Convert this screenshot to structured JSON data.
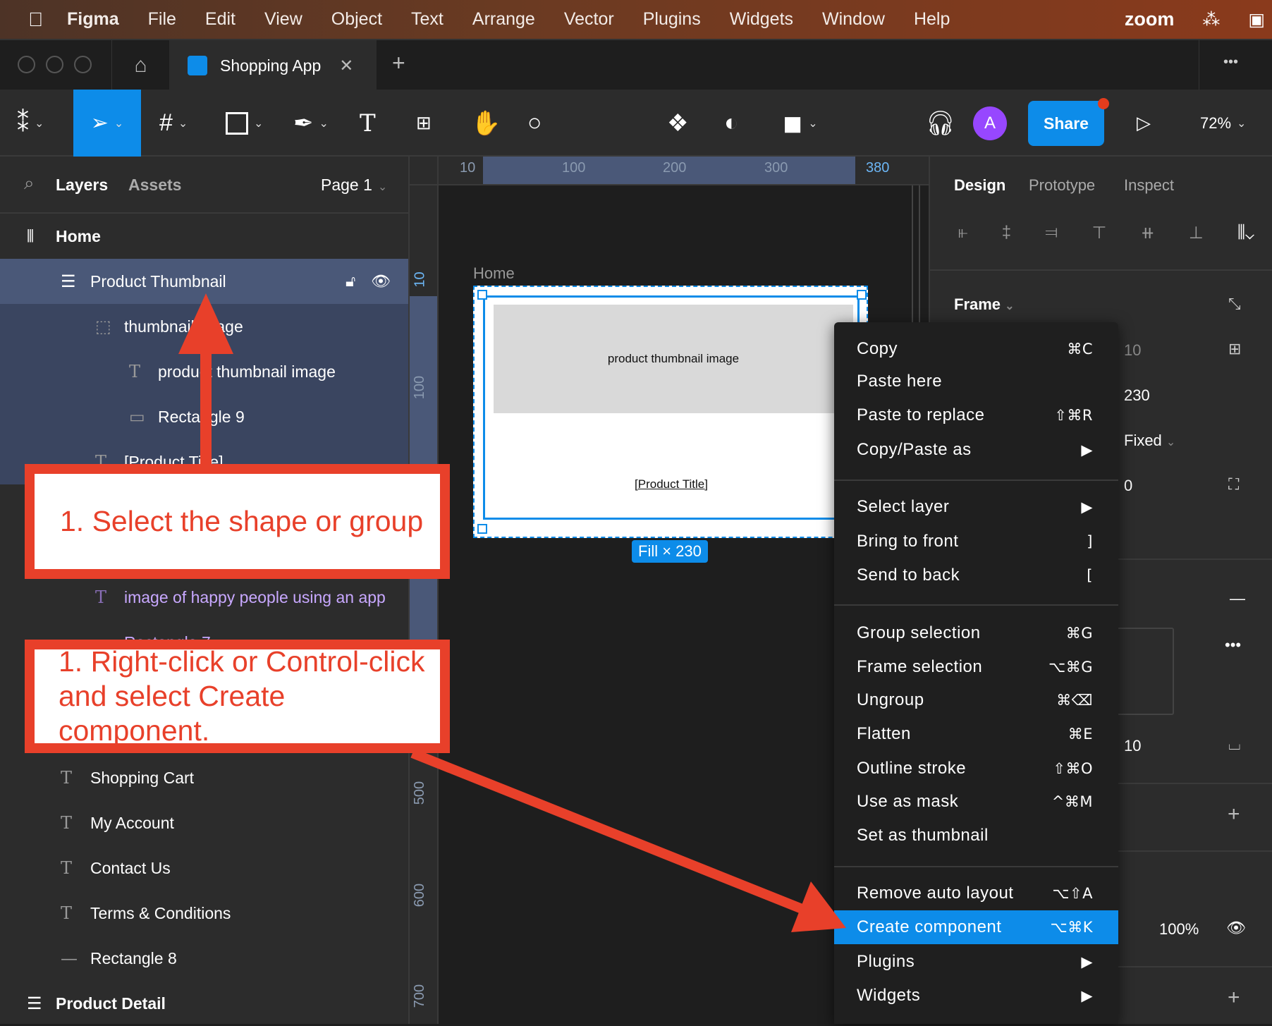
{
  "menubar": {
    "items": [
      "Figma",
      "File",
      "Edit",
      "View",
      "Object",
      "Text",
      "Arrange",
      "Vector",
      "Plugins",
      "Widgets",
      "Window",
      "Help"
    ],
    "status": [
      "zoom"
    ]
  },
  "tabbar": {
    "tab_title": "Shopping App",
    "new_tab": "+",
    "more": "•••"
  },
  "toolbar": {
    "avatar": "A",
    "share": "Share",
    "zoom": "72%",
    "accent": "#0d8ce9",
    "avatar_color": "#9747ff"
  },
  "layers": {
    "tabs": [
      "Layers",
      "Assets"
    ],
    "page": "Page 1",
    "rows": [
      {
        "label": "Home",
        "icon": "frame-grid-icon",
        "level": 0,
        "bold": true
      },
      {
        "label": "Product Thumbnail",
        "icon": "autolayout-icon",
        "level": 1,
        "selected": true
      },
      {
        "label": "thumbnail image",
        "icon": "frame-dashed-icon",
        "level": 2
      },
      {
        "label": "product thumbnail image",
        "icon": "text-icon",
        "level": 3
      },
      {
        "label": "Rectangle 9",
        "icon": "rectangle-icon",
        "level": 3
      },
      {
        "label": "[Product Title]",
        "icon": "text-icon",
        "level": 2
      },
      {
        "label": "image of happy people using an app",
        "icon": "text-icon",
        "level": 2,
        "purple": true
      },
      {
        "label": "Rectangle 7",
        "icon": "rectangle-icon",
        "level": 2,
        "purple": true
      },
      {
        "label": "Shopping Cart",
        "icon": "text-icon",
        "level": 1
      },
      {
        "label": "My Account",
        "icon": "text-icon",
        "level": 1
      },
      {
        "label": "Contact Us",
        "icon": "text-icon",
        "level": 1
      },
      {
        "label": "Terms & Conditions",
        "icon": "text-icon",
        "level": 1
      },
      {
        "label": "Rectangle 8",
        "icon": "line-icon",
        "level": 1
      },
      {
        "label": "Product Detail",
        "icon": "autolayout-icon",
        "level": 0,
        "bold": true
      }
    ]
  },
  "rulers": {
    "top": [
      "10",
      "100",
      "200",
      "300",
      "380"
    ],
    "left": [
      "10",
      "100",
      "500",
      "600",
      "700"
    ]
  },
  "canvas": {
    "frame_label": "Home",
    "image_text": "product thumbnail image",
    "title_text": "[Product Title]",
    "size_badge": "Fill × 230"
  },
  "design": {
    "tabs": [
      "Design",
      "Prototype",
      "Inspect"
    ],
    "frame_label": "Frame",
    "values": {
      "x": "10",
      "h": "230",
      "sizing": "Fixed",
      "rotation": "0",
      "gap": "10",
      "opacity": "100%"
    }
  },
  "context_menu": {
    "groups": [
      [
        {
          "label": "Copy",
          "shortcut": "⌘C"
        },
        {
          "label": "Paste here",
          "shortcut": ""
        },
        {
          "label": "Paste to replace",
          "shortcut": "⇧⌘R"
        },
        {
          "label": "Copy/Paste as",
          "shortcut": "▶"
        }
      ],
      [
        {
          "label": "Select layer",
          "shortcut": "▶"
        },
        {
          "label": "Bring to front",
          "shortcut": "]"
        },
        {
          "label": "Send to back",
          "shortcut": "["
        }
      ],
      [
        {
          "label": "Group selection",
          "shortcut": "⌘G"
        },
        {
          "label": "Frame selection",
          "shortcut": "⌥⌘G"
        },
        {
          "label": "Ungroup",
          "shortcut": "⌘⌫"
        },
        {
          "label": "Flatten",
          "shortcut": "⌘E"
        },
        {
          "label": "Outline stroke",
          "shortcut": "⇧⌘O"
        },
        {
          "label": "Use as mask",
          "shortcut": "^⌘M"
        },
        {
          "label": "Set as thumbnail",
          "shortcut": ""
        }
      ],
      [
        {
          "label": "Remove auto layout",
          "shortcut": "⌥⇧A"
        },
        {
          "label": "Create component",
          "shortcut": "⌥⌘K",
          "highlighted": true
        },
        {
          "label": "Plugins",
          "shortcut": "▶"
        },
        {
          "label": "Widgets",
          "shortcut": "▶"
        }
      ]
    ]
  },
  "annotations": {
    "step_select": "1. Select the shape or group",
    "step_rightclick_1": "1. Right-click or Control-click",
    "step_rightclick_2": "and select Create component.",
    "color": "#e8402a"
  }
}
